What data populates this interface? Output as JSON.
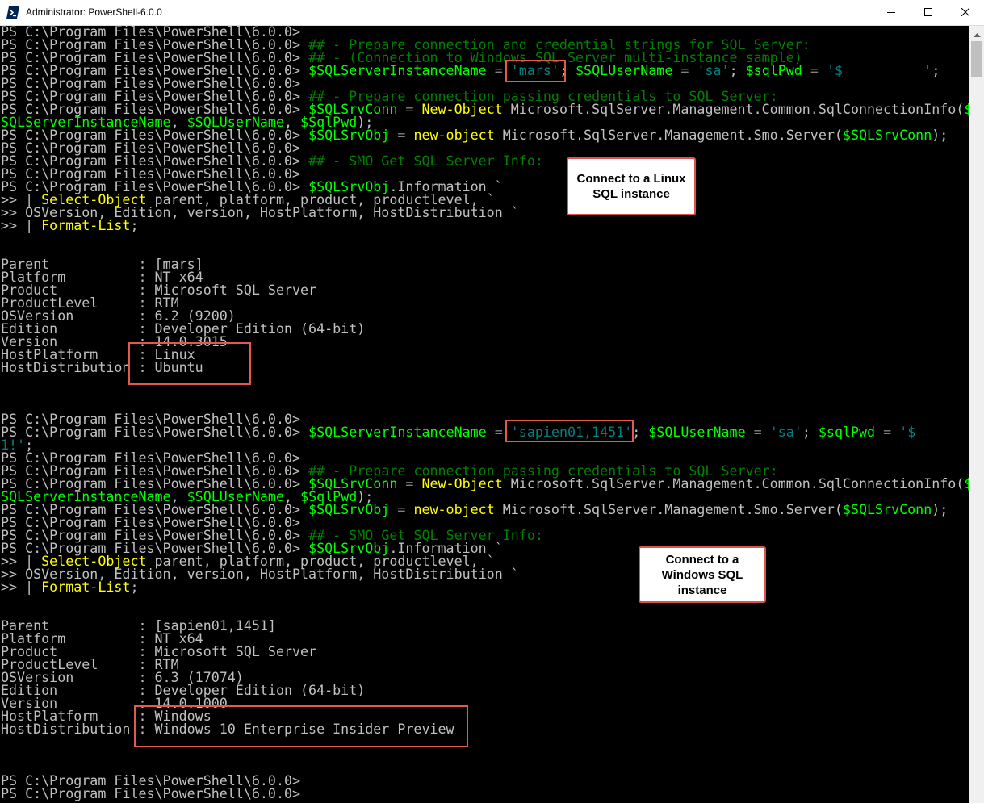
{
  "window": {
    "title": "Administrator: PowerShell-6.0.0",
    "icon": "powershell-icon",
    "buttons": {
      "minimize": "minimize-icon",
      "maximize": "maximize-icon",
      "close": "close-icon"
    }
  },
  "colors": {
    "console_bg": "#000000",
    "text": "#c0c0c0",
    "comment": "#008000",
    "variable": "#00ff00",
    "string": "#008080",
    "command": "#ffff00",
    "callout_border": "#d9534f"
  },
  "console": {
    "lines": [
      [
        {
          "t": "PS C:\\Program Files\\PowerShell\\6.0.0>",
          "c": "prompt"
        }
      ],
      [
        {
          "t": "PS C:\\Program Files\\PowerShell\\6.0.0> ",
          "c": "prompt"
        },
        {
          "t": "## - Prepare connection and credential strings for SQL Server:",
          "c": "comment"
        }
      ],
      [
        {
          "t": "PS C:\\Program Files\\PowerShell\\6.0.0> ",
          "c": "prompt"
        },
        {
          "t": "## - (Connection to Windows SQL Server multi-instance sample)",
          "c": "comment"
        }
      ],
      [
        {
          "t": "PS C:\\Program Files\\PowerShell\\6.0.0> ",
          "c": "prompt"
        },
        {
          "t": "$SQLServerInstanceName",
          "c": "var"
        },
        {
          "t": " = ",
          "c": "op"
        },
        {
          "t": "'mars'",
          "c": "str"
        },
        {
          "t": "; ",
          "c": "arg"
        },
        {
          "t": "$SQLUserName",
          "c": "var"
        },
        {
          "t": " = ",
          "c": "op"
        },
        {
          "t": "'sa'",
          "c": "str"
        },
        {
          "t": "; ",
          "c": "arg"
        },
        {
          "t": "$sqlPwd",
          "c": "var"
        },
        {
          "t": " = ",
          "c": "op"
        },
        {
          "t": "'$          '",
          "c": "str"
        },
        {
          "t": ";",
          "c": "arg"
        }
      ],
      [
        {
          "t": "PS C:\\Program Files\\PowerShell\\6.0.0>",
          "c": "prompt"
        }
      ],
      [
        {
          "t": "PS C:\\Program Files\\PowerShell\\6.0.0> ",
          "c": "prompt"
        },
        {
          "t": "## - Prepare connection passing credentials to SQL Server:",
          "c": "comment"
        }
      ],
      [
        {
          "t": "PS C:\\Program Files\\PowerShell\\6.0.0> ",
          "c": "prompt"
        },
        {
          "t": "$SQLSrvConn",
          "c": "var"
        },
        {
          "t": " = ",
          "c": "op"
        },
        {
          "t": "New-Object",
          "c": "cmd"
        },
        {
          "t": " Microsoft.SqlServer.Management.Common.SqlConnectionInfo(",
          "c": "arg"
        },
        {
          "t": "$",
          "c": "var"
        }
      ],
      [
        {
          "t": "SQLServerInstanceName",
          "c": "var"
        },
        {
          "t": ", ",
          "c": "arg"
        },
        {
          "t": "$SQLUserName",
          "c": "var"
        },
        {
          "t": ", ",
          "c": "arg"
        },
        {
          "t": "$SqlPwd",
          "c": "var"
        },
        {
          "t": ");",
          "c": "arg"
        }
      ],
      [
        {
          "t": "PS C:\\Program Files\\PowerShell\\6.0.0> ",
          "c": "prompt"
        },
        {
          "t": "$SQLSrvObj",
          "c": "var"
        },
        {
          "t": " = ",
          "c": "op"
        },
        {
          "t": "new-object",
          "c": "cmd"
        },
        {
          "t": " Microsoft.SqlServer.Management.Smo.Server(",
          "c": "arg"
        },
        {
          "t": "$SQLSrvConn",
          "c": "var"
        },
        {
          "t": ");",
          "c": "arg"
        }
      ],
      [
        {
          "t": "PS C:\\Program Files\\PowerShell\\6.0.0>",
          "c": "prompt"
        }
      ],
      [
        {
          "t": "PS C:\\Program Files\\PowerShell\\6.0.0> ",
          "c": "prompt"
        },
        {
          "t": "## - SMO Get SQL Server Info:",
          "c": "comment"
        }
      ],
      [
        {
          "t": "PS C:\\Program Files\\PowerShell\\6.0.0>",
          "c": "prompt"
        }
      ],
      [
        {
          "t": "PS C:\\Program Files\\PowerShell\\6.0.0> ",
          "c": "prompt"
        },
        {
          "t": "$SQLSrvObj",
          "c": "var"
        },
        {
          "t": ".Information `",
          "c": "arg"
        }
      ],
      [
        {
          "t": ">> | ",
          "c": "prompt"
        },
        {
          "t": "Select-Object",
          "c": "cmd"
        },
        {
          "t": " parent, platform, product, productlevel, `",
          "c": "arg"
        }
      ],
      [
        {
          "t": ">> OSVersion, Edition, version, HostPlatform, HostDistribution `",
          "c": "arg"
        }
      ],
      [
        {
          "t": ">> | ",
          "c": "prompt"
        },
        {
          "t": "Format-List",
          "c": "cmd"
        },
        {
          "t": ";",
          "c": "arg"
        }
      ],
      [],
      [],
      [
        {
          "t": "Parent           : [mars]",
          "c": "out"
        }
      ],
      [
        {
          "t": "Platform         : NT x64",
          "c": "out"
        }
      ],
      [
        {
          "t": "Product          : Microsoft SQL Server",
          "c": "out"
        }
      ],
      [
        {
          "t": "ProductLevel     : RTM",
          "c": "out"
        }
      ],
      [
        {
          "t": "OSVersion        : 6.2 (9200)",
          "c": "out"
        }
      ],
      [
        {
          "t": "Edition          : Developer Edition (64-bit)",
          "c": "out"
        }
      ],
      [
        {
          "t": "Version          : 14.0.3015",
          "c": "out"
        }
      ],
      [
        {
          "t": "HostPlatform     : Linux",
          "c": "out"
        }
      ],
      [
        {
          "t": "HostDistribution : Ubuntu",
          "c": "out"
        }
      ],
      [],
      [],
      [],
      [
        {
          "t": "PS C:\\Program Files\\PowerShell\\6.0.0>",
          "c": "prompt"
        }
      ],
      [
        {
          "t": "PS C:\\Program Files\\PowerShell\\6.0.0> ",
          "c": "prompt"
        },
        {
          "t": "$SQLServerInstanceName",
          "c": "var"
        },
        {
          "t": " = ",
          "c": "op"
        },
        {
          "t": "'sapien01,1451'",
          "c": "str"
        },
        {
          "t": "; ",
          "c": "arg"
        },
        {
          "t": "$SQLUserName",
          "c": "var"
        },
        {
          "t": " = ",
          "c": "op"
        },
        {
          "t": "'sa'",
          "c": "str"
        },
        {
          "t": "; ",
          "c": "arg"
        },
        {
          "t": "$sqlPwd",
          "c": "var"
        },
        {
          "t": " = ",
          "c": "op"
        },
        {
          "t": "'$        0",
          "c": "str"
        }
      ],
      [
        {
          "t": "1!'",
          "c": "str"
        },
        {
          "t": ";",
          "c": "arg"
        }
      ],
      [
        {
          "t": "PS C:\\Program Files\\PowerShell\\6.0.0>",
          "c": "prompt"
        }
      ],
      [
        {
          "t": "PS C:\\Program Files\\PowerShell\\6.0.0> ",
          "c": "prompt"
        },
        {
          "t": "## - Prepare connection passing credentials to SQL Server:",
          "c": "comment"
        }
      ],
      [
        {
          "t": "PS C:\\Program Files\\PowerShell\\6.0.0> ",
          "c": "prompt"
        },
        {
          "t": "$SQLSrvConn",
          "c": "var"
        },
        {
          "t": " = ",
          "c": "op"
        },
        {
          "t": "New-Object",
          "c": "cmd"
        },
        {
          "t": " Microsoft.SqlServer.Management.Common.SqlConnectionInfo(",
          "c": "arg"
        },
        {
          "t": "$",
          "c": "var"
        }
      ],
      [
        {
          "t": "SQLServerInstanceName",
          "c": "var"
        },
        {
          "t": ", ",
          "c": "arg"
        },
        {
          "t": "$SQLUserName",
          "c": "var"
        },
        {
          "t": ", ",
          "c": "arg"
        },
        {
          "t": "$SqlPwd",
          "c": "var"
        },
        {
          "t": ");",
          "c": "arg"
        }
      ],
      [
        {
          "t": "PS C:\\Program Files\\PowerShell\\6.0.0> ",
          "c": "prompt"
        },
        {
          "t": "$SQLSrvObj",
          "c": "var"
        },
        {
          "t": " = ",
          "c": "op"
        },
        {
          "t": "new-object",
          "c": "cmd"
        },
        {
          "t": " Microsoft.SqlServer.Management.Smo.Server(",
          "c": "arg"
        },
        {
          "t": "$SQLSrvConn",
          "c": "var"
        },
        {
          "t": ");",
          "c": "arg"
        }
      ],
      [
        {
          "t": "PS C:\\Program Files\\PowerShell\\6.0.0>",
          "c": "prompt"
        }
      ],
      [
        {
          "t": "PS C:\\Program Files\\PowerShell\\6.0.0> ",
          "c": "prompt"
        },
        {
          "t": "## - SMO Get SQL Server Info:",
          "c": "comment"
        }
      ],
      [
        {
          "t": "PS C:\\Program Files\\PowerShell\\6.0.0> ",
          "c": "prompt"
        },
        {
          "t": "$SQLSrvObj",
          "c": "var"
        },
        {
          "t": ".Information `",
          "c": "arg"
        }
      ],
      [
        {
          "t": ">> | ",
          "c": "prompt"
        },
        {
          "t": "Select-Object",
          "c": "cmd"
        },
        {
          "t": " parent, platform, product, productlevel, `",
          "c": "arg"
        }
      ],
      [
        {
          "t": ">> OSVersion, Edition, version, HostPlatform, HostDistribution `",
          "c": "arg"
        }
      ],
      [
        {
          "t": ">> | ",
          "c": "prompt"
        },
        {
          "t": "Format-List",
          "c": "cmd"
        },
        {
          "t": ";",
          "c": "arg"
        }
      ],
      [],
      [],
      [
        {
          "t": "Parent           : [sapien01,1451]",
          "c": "out"
        }
      ],
      [
        {
          "t": "Platform         : NT x64",
          "c": "out"
        }
      ],
      [
        {
          "t": "Product          : Microsoft SQL Server",
          "c": "out"
        }
      ],
      [
        {
          "t": "ProductLevel     : RTM",
          "c": "out"
        }
      ],
      [
        {
          "t": "OSVersion        : 6.3 (17074)",
          "c": "out"
        }
      ],
      [
        {
          "t": "Edition          : Developer Edition (64-bit)",
          "c": "out"
        }
      ],
      [
        {
          "t": "Version          : 14.0.1000",
          "c": "out"
        }
      ],
      [
        {
          "t": "HostPlatform     : Windows",
          "c": "out"
        }
      ],
      [
        {
          "t": "HostDistribution : Windows 10 Enterprise Insider Preview",
          "c": "out"
        }
      ],
      [],
      [],
      [],
      [
        {
          "t": "PS C:\\Program Files\\PowerShell\\6.0.0>",
          "c": "prompt"
        }
      ],
      [
        {
          "t": "PS C:\\Program Files\\PowerShell\\6.0.0>",
          "c": "prompt"
        }
      ]
    ]
  },
  "callouts": {
    "linux": "Connect to a Linux\nSQL instance",
    "windows": "Connect to a\nWindows SQL\ninstance"
  }
}
